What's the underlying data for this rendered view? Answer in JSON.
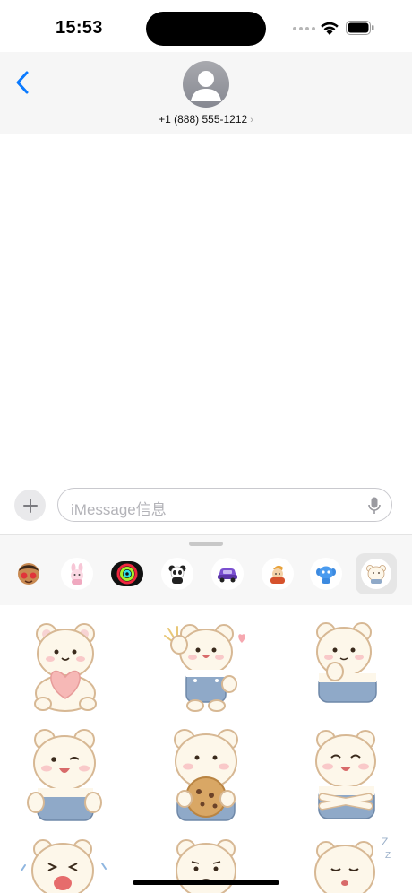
{
  "status_bar": {
    "time": "15:53",
    "wifi_icon": "wifi-icon",
    "battery_icon": "battery-icon"
  },
  "header": {
    "back_icon": "chevron-left-icon",
    "avatar_icon": "person-avatar-icon",
    "contact_number": "+1 (888) 555-1212",
    "contact_chevron": "›"
  },
  "compose": {
    "plus_icon": "plus-icon",
    "placeholder": "iMessage信息",
    "mic_icon": "microphone-icon"
  },
  "drawer": {
    "apps": [
      {
        "name": "memoji-stickers-app"
      },
      {
        "name": "pink-bunny-app"
      },
      {
        "name": "activity-rings-app"
      },
      {
        "name": "panda-app"
      },
      {
        "name": "purple-car-app"
      },
      {
        "name": "character-sticker-app"
      },
      {
        "name": "blue-monster-app"
      },
      {
        "name": "white-bear-app",
        "selected": true
      }
    ],
    "stickers": [
      "bear-holding-heart-sticker",
      "bear-waving-sticker",
      "bear-thinking-sticker",
      "bear-winking-sticker",
      "bear-eating-cookie-sticker",
      "bear-smiling-sticker",
      "bear-crying-sticker",
      "bear-confused-sticker",
      "bear-sleeping-sticker"
    ]
  },
  "colors": {
    "accent": "#0a7aff",
    "header_bg": "#f6f6f6",
    "bear_cream": "#fdf7ea",
    "bear_outline": "#c7a27a",
    "overalls": "#8fa9c8"
  }
}
